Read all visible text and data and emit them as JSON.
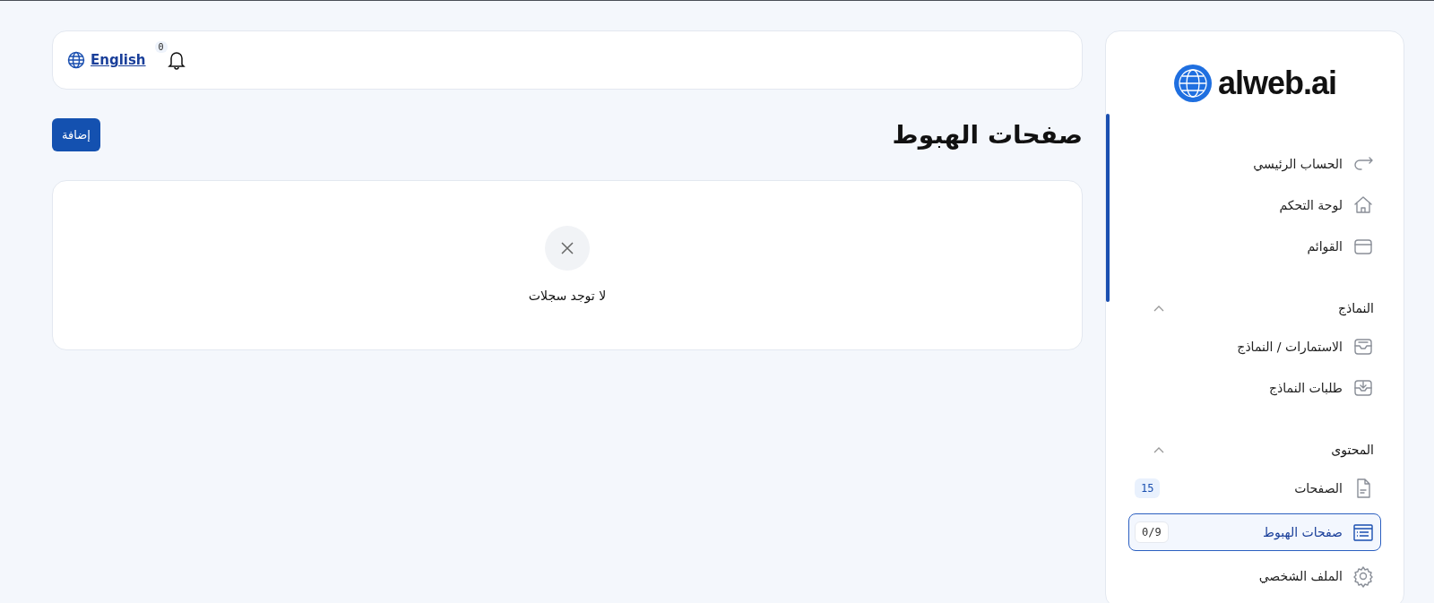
{
  "topbar": {
    "language_link": "English",
    "notification_count": "0"
  },
  "page": {
    "title": "صفحات الهبوط",
    "add_button": "إضافة"
  },
  "empty_state": {
    "message": "لا توجد سجلات"
  },
  "sidebar": {
    "logo": "alweb.ai",
    "sections": [
      {
        "items": [
          {
            "label": "الحساب الرئيسي",
            "selected": false
          },
          {
            "label": "لوحة التحكم",
            "selected": false
          },
          {
            "label": "القوائم",
            "selected": false
          }
        ]
      },
      {
        "title": "النماذج",
        "expanded": true,
        "items": [
          {
            "label": "الاستمارات / النماذج",
            "selected": false
          },
          {
            "label": "طلبات النماذج",
            "selected": false
          }
        ]
      },
      {
        "title": "المحتوى",
        "expanded": true,
        "items": [
          {
            "label": "الصفحات",
            "selected": false,
            "badge": "15"
          },
          {
            "label": "صفحات الهبوط",
            "selected": true,
            "badge": "0/9"
          },
          {
            "label": "الملف الشخصي",
            "selected": false
          }
        ]
      }
    ]
  }
}
